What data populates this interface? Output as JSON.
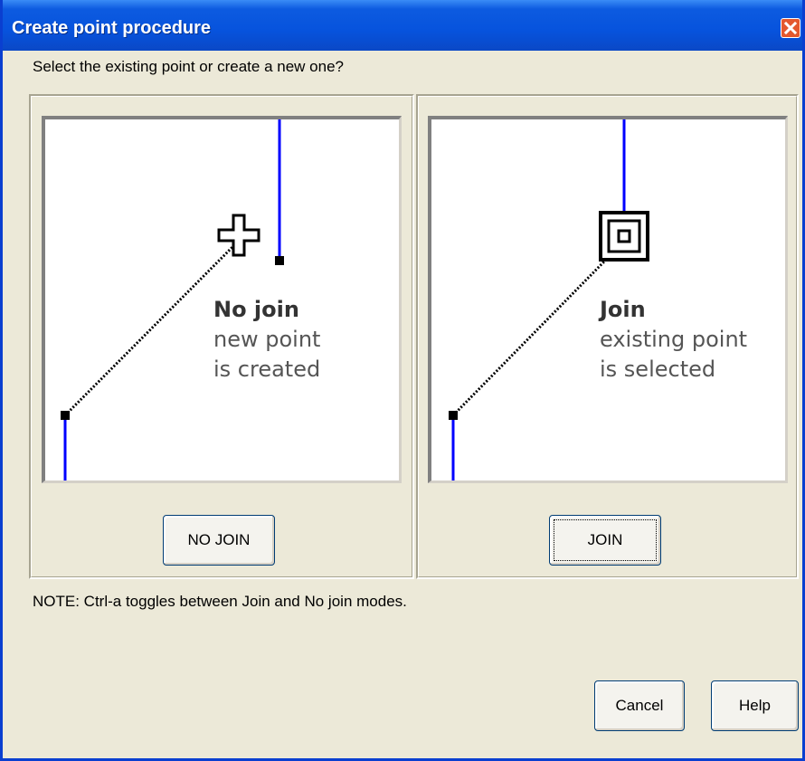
{
  "window": {
    "title": "Create point procedure",
    "prompt": "Select the existing point or create a new one?",
    "note": "NOTE: Ctrl-a toggles between Join and No join modes."
  },
  "left_panel": {
    "caption_title": "No join",
    "caption_line1": "new point",
    "caption_line2": "is created",
    "button_label": "NO JOIN"
  },
  "right_panel": {
    "caption_title": "Join",
    "caption_line1": "existing point",
    "caption_line2": "is selected",
    "button_label": "JOIN"
  },
  "footer": {
    "cancel_label": "Cancel",
    "help_label": "Help"
  },
  "colors": {
    "titlebar": "#0753dd",
    "line_blue": "#0000ff",
    "face": "#ece9d8",
    "close": "#e4582e"
  },
  "icons": [
    "close-icon",
    "crosshair-cursor-icon",
    "snap-target-icon"
  ]
}
